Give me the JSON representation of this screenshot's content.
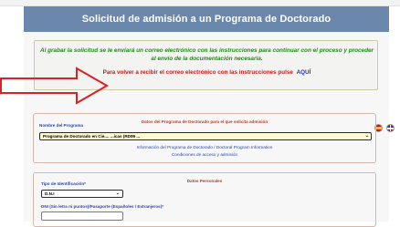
{
  "header": {
    "title": "Solicitud de admisión a un Programa de Doctorado"
  },
  "notice": {
    "info_text": "Al grabar la solicitud se le enviará un correo electrónico con las instrucciones para continuar con el proceso y proceder al envío de la documentación necesaria.",
    "resend_text": "Para volver a recibir el correo electrónico con las instrucciones pulse",
    "resend_link": "AQUÍ"
  },
  "languages": [
    {
      "name": "es-flag-icon"
    },
    {
      "name": "uk-flag-icon"
    }
  ],
  "program_section": {
    "legend": "Datos del Programa de Doctorado para el que solicita admisión",
    "program_label": "Nombre del Programa",
    "program_value": "Programa de Doctorado en Cie.... ...icas (RD99 ...",
    "info_link": "Información del Programa de Doctorado / Doctoral Program Information",
    "access_link": "Condiciones de acceso y admisión"
  },
  "personal_section": {
    "legend": "Datos Personales",
    "id_type_label": "Tipo de Identificación*",
    "id_type_value": "D.N.I",
    "dni_label": "DNI (Sin letra ni puntos)/Pasaporte (Españoles / Extranjeros)*",
    "dni_value": ""
  },
  "colors": {
    "title_bar": "#6b87ac",
    "notice_green": "#1f8a16",
    "notice_red": "#cc1818",
    "arrow_red": "#e02020",
    "label_blue": "#2c47a8",
    "select_yellow": "#fffbd4"
  }
}
